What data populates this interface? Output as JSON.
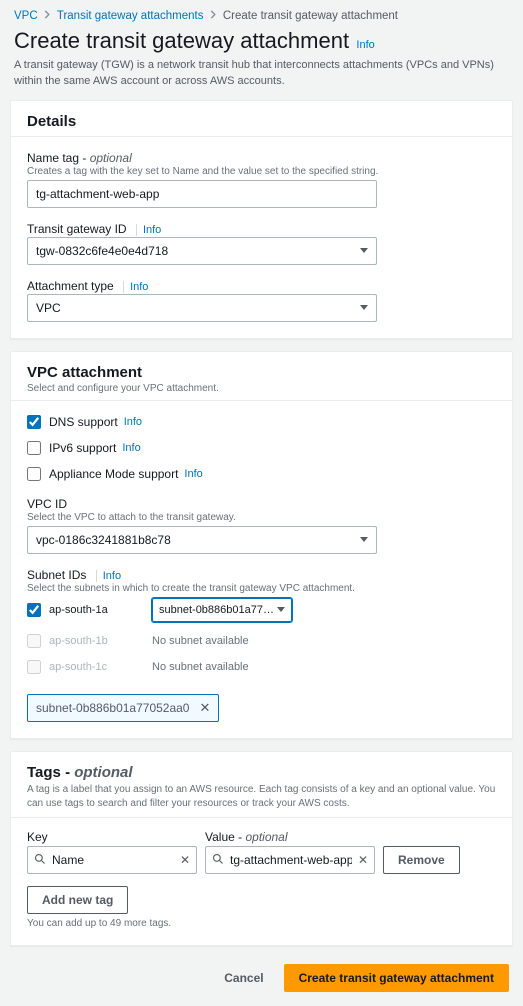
{
  "breadcrumb": {
    "vpc": "VPC",
    "tga": "Transit gateway attachments",
    "current": "Create transit gateway attachment"
  },
  "header": {
    "title": "Create transit gateway attachment",
    "info": "Info",
    "desc": "A transit gateway (TGW) is a network transit hub that interconnects attachments (VPCs and VPNs) within the same AWS account or across AWS accounts."
  },
  "details": {
    "title": "Details",
    "name_label": "Name tag - ",
    "name_optional": "optional",
    "name_help": "Creates a tag with the key set to Name and the value set to the specified string.",
    "name_value": "tg-attachment-web-app",
    "tgw_label": "Transit gateway ID",
    "info": "Info",
    "tgw_value": "tgw-0832c6fe4e0e4d718",
    "atype_label": "Attachment type",
    "atype_value": "VPC"
  },
  "vpcatt": {
    "title": "VPC attachment",
    "sub": "Select and configure your VPC attachment.",
    "dns_label": "DNS support",
    "ipv6_label": "IPv6 support",
    "appliance_label": "Appliance Mode support",
    "info": "Info",
    "vpcid_label": "VPC ID",
    "vpcid_help": "Select the VPC to attach to the transit gateway.",
    "vpcid_value": "vpc-0186c3241881b8c78",
    "subnet_label": "Subnet IDs",
    "subnet_help": "Select the subnets in which to create the transit gateway VPC attachment.",
    "zones": {
      "a": "ap-south-1a",
      "b": "ap-south-1b",
      "c": "ap-south-1c"
    },
    "subnet_selected": "subnet-0b886b01a77052aa0",
    "no_subnet": "No subnet available",
    "token": "subnet-0b886b01a77052aa0"
  },
  "tags": {
    "title": "Tags - ",
    "optional": "optional",
    "desc": "A tag is a label that you assign to an AWS resource. Each tag consists of a key and an optional value. You can use tags to search and filter your resources or track your AWS costs.",
    "key_label": "Key",
    "value_label": "Value - ",
    "value_optional": "optional",
    "key": "Name",
    "value": "tg-attachment-web-app",
    "remove": "Remove",
    "add": "Add new tag",
    "note": "You can add up to 49 more tags."
  },
  "footer": {
    "cancel": "Cancel",
    "create": "Create transit gateway attachment"
  }
}
